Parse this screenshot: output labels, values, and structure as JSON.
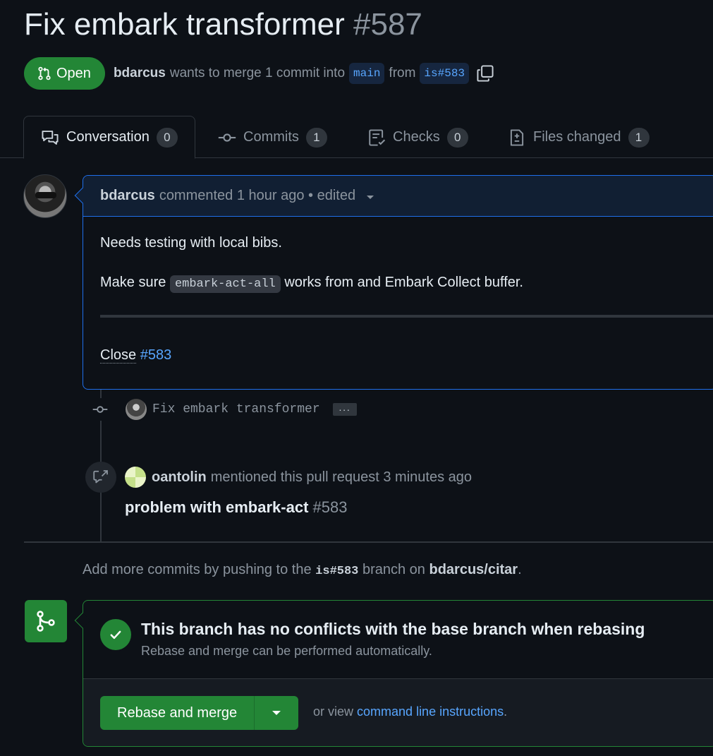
{
  "pr": {
    "title": "Fix embark transformer",
    "number": "#587",
    "state": "Open",
    "author": "bdarcus",
    "merge_text": "wants to merge 1 commit into",
    "base_branch": "main",
    "from_text": "from",
    "head_branch": "is#583"
  },
  "tabs": [
    {
      "label": "Conversation",
      "count": "0",
      "icon": "comment-discussion-icon"
    },
    {
      "label": "Commits",
      "count": "1",
      "icon": "git-commit-icon"
    },
    {
      "label": "Checks",
      "count": "0",
      "icon": "checklist-icon"
    },
    {
      "label": "Files changed",
      "count": "1",
      "icon": "file-diff-icon"
    }
  ],
  "comment": {
    "author": "bdarcus",
    "meta": "commented 1 hour ago • edited",
    "line1": "Needs testing with local bibs.",
    "line2_before": "Make sure",
    "line2_code": "embark-act-all",
    "line2_after": "works from and Embark Collect buffer.",
    "close_text": "Close",
    "close_ref": "#583"
  },
  "commit": {
    "message": "Fix embark transformer",
    "more": "···"
  },
  "mention": {
    "author": "oantolin",
    "text": "mentioned this pull request 3 minutes ago",
    "ref_title": "problem with embark-act",
    "ref_number": "#583"
  },
  "push_hint": {
    "before": "Add more commits by pushing to the",
    "branch": "is#583",
    "middle": "branch on",
    "repo": "bdarcus/citar",
    "end": "."
  },
  "merge": {
    "title": "This branch has no conflicts with the base branch when rebasing",
    "subtitle": "Rebase and merge can be performed automatically.",
    "button": "Rebase and merge",
    "or_view": "or view",
    "cli_link": "command line instructions",
    "period": "."
  },
  "colors": {
    "background": "#0d1117",
    "accent_green": "#238636",
    "link_blue": "#58a6ff"
  }
}
